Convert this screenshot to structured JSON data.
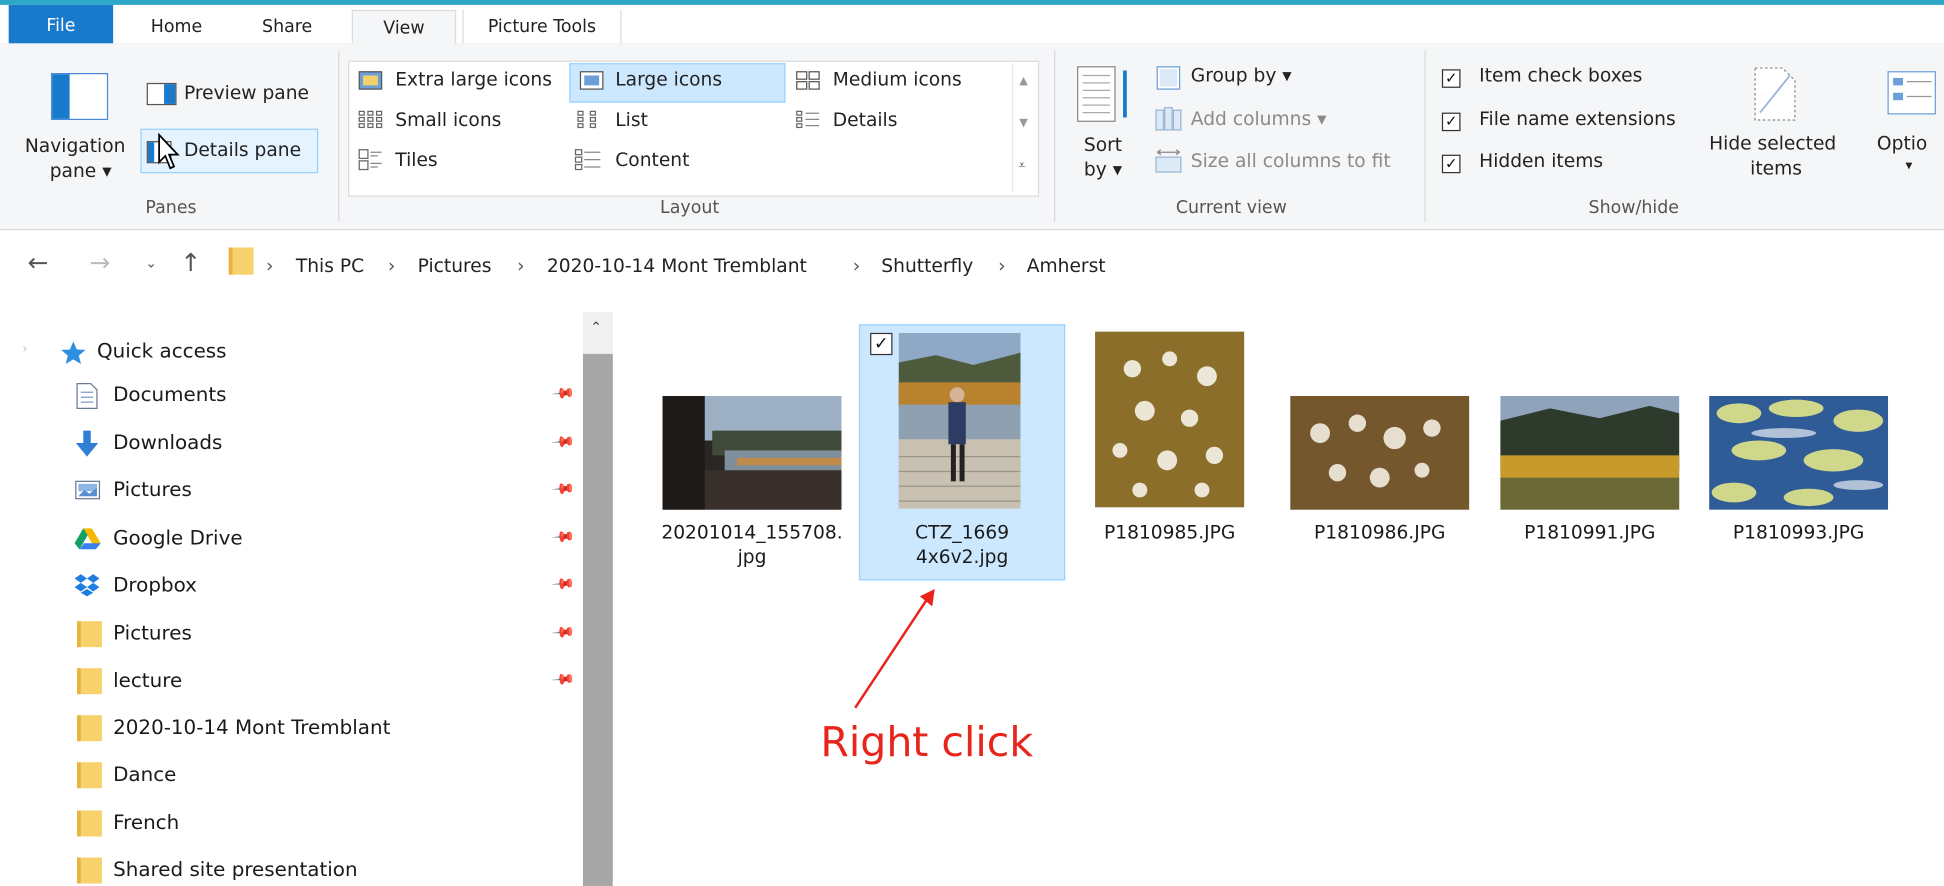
{
  "ribbon": {
    "tabs": [
      "File",
      "Home",
      "Share",
      "View",
      "Picture Tools"
    ],
    "panes": {
      "navigation_pane": "Navigation",
      "navigation_pane_sub": "pane ▾",
      "preview_pane": "Preview pane",
      "details_pane": "Details pane",
      "group_label": "Panes"
    },
    "layout": {
      "extra_large": "Extra large icons",
      "large": "Large icons",
      "medium": "Medium icons",
      "small": "Small icons",
      "list": "List",
      "details": "Details",
      "tiles": "Tiles",
      "content": "Content",
      "group_label": "Layout"
    },
    "current_view": {
      "sort": "Sort",
      "sort_sub": "by ▾",
      "group_by": "Group by ▾",
      "add_columns": "Add columns ▾",
      "size_columns": "Size all columns to fit",
      "group_label": "Current view"
    },
    "show_hide": {
      "item_check_boxes": "Item check boxes",
      "file_name_extensions": "File name extensions",
      "hidden_items": "Hidden items",
      "hide_selected": "Hide selected",
      "hide_selected_sub": "items",
      "options": "Optio",
      "options_arrow": "▾",
      "group_label": "Show/hide",
      "checked": "✓"
    }
  },
  "address": {
    "crumbs": [
      "This PC",
      "Pictures",
      "2020-10-14 Mont Tremblant",
      "Shutterfly",
      "Amherst"
    ],
    "separator": "›"
  },
  "sidebar": {
    "quick_access": "Quick access",
    "items": [
      "Documents",
      "Downloads",
      "Pictures",
      "Google Drive",
      "Dropbox",
      "Pictures",
      "lecture",
      "2020-10-14 Mont Tremblant",
      "Dance",
      "French",
      "Shared site presentation"
    ]
  },
  "files": [
    {
      "line1": "20201014_155708.",
      "line2": "jpg"
    },
    {
      "line1": "CTZ_1669",
      "line2": "4x6v2.jpg"
    },
    {
      "line1": "P1810985.JPG",
      "line2": ""
    },
    {
      "line1": "P1810986.JPG",
      "line2": ""
    },
    {
      "line1": "P1810991.JPG",
      "line2": ""
    },
    {
      "line1": "P1810993.JPG",
      "line2": ""
    }
  ],
  "annotation": {
    "text": "Right click",
    "color": "#e8241c"
  },
  "colors": {
    "accent": "#1979ca",
    "selection": "#cce8ff",
    "selection_border": "#99d1ff"
  }
}
